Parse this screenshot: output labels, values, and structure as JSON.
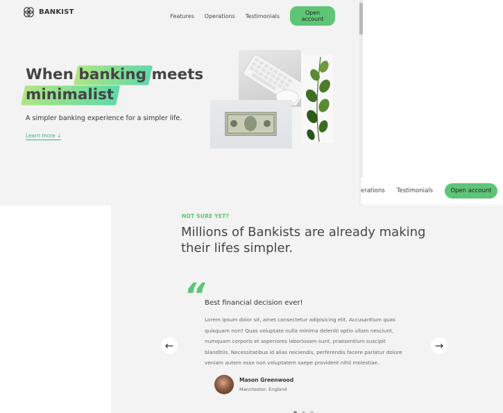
{
  "hero_window": {
    "nav": {
      "logo_text": "BANKIST",
      "links": [
        "Features",
        "Operations",
        "Testimonials"
      ],
      "cta": "Open account"
    },
    "title": {
      "part1": "When",
      "highlight1": "banking",
      "part2": "meets",
      "highlight2": "minimalist"
    },
    "subtitle": "A simpler banking experience for a simpler life.",
    "learn_more": "Learn more ↓"
  },
  "sticky_nav": {
    "links": [
      "erations",
      "Testimonials"
    ],
    "cta": "Open account"
  },
  "testimonials": {
    "label": "NOT SURE YET?",
    "heading": "Millions of Bankists are already making their lifes simpler.",
    "quote_mark": "“",
    "slide": {
      "title": "Best financial decision ever!",
      "text": "Lorem ipsum dolor sit, amet consectetur adipisicing elit. Accusantium quas quisquam non? Quas voluptate nulla minima deleniti optio ullam nesciunt, numquam corporis et asperiores laboriosam sunt, praesentium suscipit blanditiis. Necessitatibus id alias reiciendis, perferendis facere pariatur dolore veniam autem esse non voluptatem saepe provident nihil molestiae.",
      "author_name": "Mason Greenwood",
      "author_location": "Manchester, England"
    },
    "slider_left": "←",
    "slider_right": "→",
    "active_dot": 0,
    "dot_count": 3
  },
  "colors": {
    "accent": "#5ec576",
    "background": "#f3f3f3",
    "text": "#444444"
  }
}
